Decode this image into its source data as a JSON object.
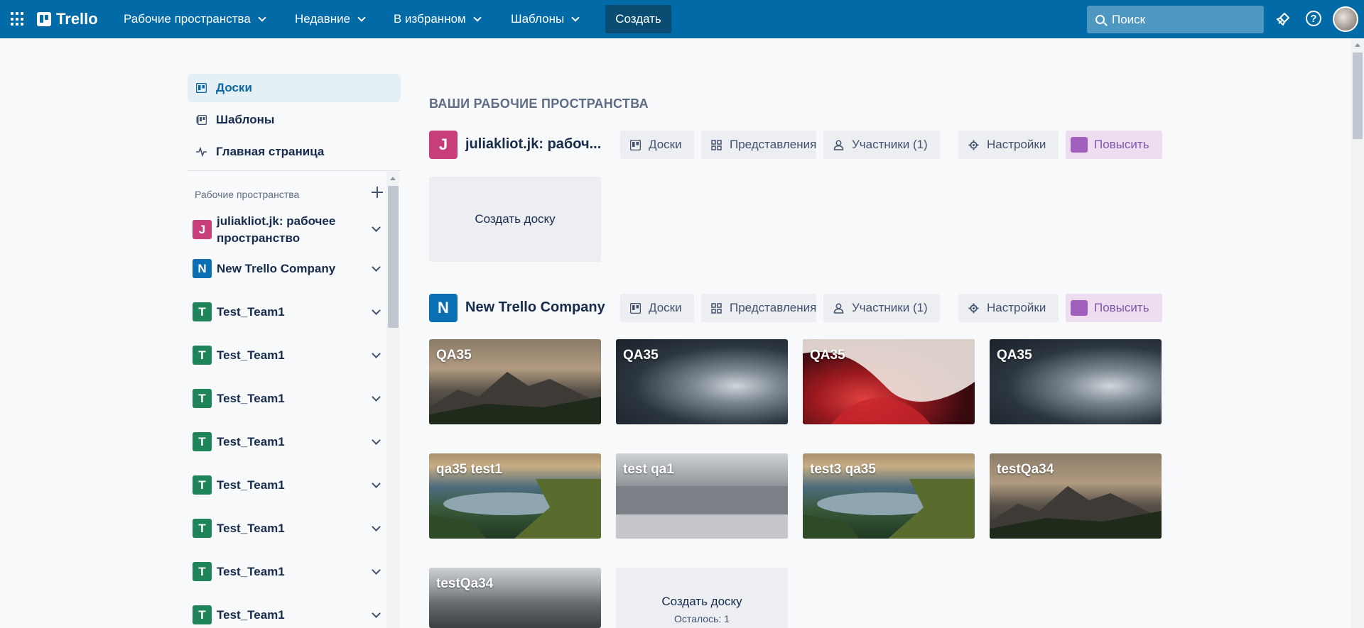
{
  "header": {
    "logo": "Trello",
    "nav": [
      {
        "label": "Рабочие пространства"
      },
      {
        "label": "Недавние"
      },
      {
        "label": "В избранном"
      },
      {
        "label": "Шаблоны"
      }
    ],
    "create_label": "Создать",
    "search_placeholder": "Поиск"
  },
  "sidebar": {
    "links": [
      {
        "label": "Доски",
        "icon": "board-icon",
        "active": true
      },
      {
        "label": "Шаблоны",
        "icon": "template-icon",
        "active": false
      },
      {
        "label": "Главная страница",
        "icon": "activity-icon",
        "active": false
      }
    ],
    "workspaces_header": "Рабочие пространства",
    "workspaces": [
      {
        "letter": "J",
        "name": "juliakliot.jk: рабочее пространство",
        "color": "#c83e7a"
      },
      {
        "letter": "N",
        "name": "New Trello Company",
        "color": "#0b6fb3"
      },
      {
        "letter": "T",
        "name": "Test_Team1",
        "color": "#1f845a"
      },
      {
        "letter": "T",
        "name": "Test_Team1",
        "color": "#1f845a"
      },
      {
        "letter": "T",
        "name": "Test_Team1",
        "color": "#1f845a"
      },
      {
        "letter": "T",
        "name": "Test_Team1",
        "color": "#1f845a"
      },
      {
        "letter": "T",
        "name": "Test_Team1",
        "color": "#1f845a"
      },
      {
        "letter": "T",
        "name": "Test_Team1",
        "color": "#1f845a"
      },
      {
        "letter": "T",
        "name": "Test_Team1",
        "color": "#1f845a"
      },
      {
        "letter": "T",
        "name": "Test_Team1",
        "color": "#1f845a"
      }
    ]
  },
  "main": {
    "title": "ВАШИ РАБОЧИЕ ПРОСТРАНСТВА",
    "workspace_buttons": {
      "boards": "Доски",
      "views": "Представления",
      "members": "Участники (1)",
      "settings": "Настройки",
      "upgrade": "Повысить"
    },
    "workspaces": [
      {
        "letter": "J",
        "name": "juliakliot.jk: рабоч...",
        "color": "#c83e7a",
        "create_tile": {
          "label": "Создать доску"
        }
      },
      {
        "letter": "N",
        "name": "New Trello Company",
        "color": "#0b6fb3",
        "boards": [
          {
            "title": "QA35",
            "bg": "mountain"
          },
          {
            "title": "QA35",
            "bg": "storm"
          },
          {
            "title": "QA35",
            "bg": "red-abstract"
          },
          {
            "title": "QA35",
            "bg": "storm"
          },
          {
            "title": "qa35 test1",
            "bg": "coast"
          },
          {
            "title": "test qa1",
            "bg": "forest"
          },
          {
            "title": "test3 qa35",
            "bg": "coast"
          },
          {
            "title": "testQa34",
            "bg": "mountain"
          },
          {
            "title": "testQa34",
            "bg": "forest"
          }
        ],
        "create_tile": {
          "label": "Создать доску",
          "remaining": "Осталось: 1"
        }
      }
    ]
  }
}
